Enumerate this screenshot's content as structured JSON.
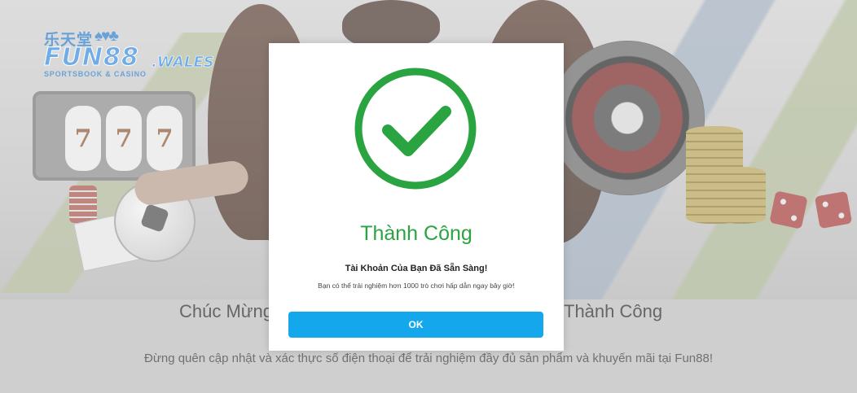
{
  "logo": {
    "chinese_text": "乐天堂",
    "suits": "♠♥♣",
    "brand": "FUN88",
    "tld": ".WALES",
    "tagline": "SPORTSBOOK & CASINO"
  },
  "background": {
    "slot_symbols": [
      "7",
      "7",
      "7"
    ],
    "heading_left": "Chúc Mừng",
    "heading_right": "Thành Công",
    "note": "Đừng quên cập nhật và xác thực số điện thoại để trải nghiệm đầy đủ sản phẩm và khuyến mãi tại Fun88!"
  },
  "modal": {
    "icon": "check-circle-icon",
    "title": "Thành Công",
    "subtitle": "Tài Khoản Của Bạn Đã Sẵn Sàng!",
    "message": "Bạn có thể trải nghiệm hơn 1000 trò chơi hấp dẫn ngay bây giờ!",
    "ok_label": "OK"
  },
  "colors": {
    "success_green": "#2aa441",
    "button_blue": "#14a7ec",
    "brand_blue": "#3a8dde"
  }
}
